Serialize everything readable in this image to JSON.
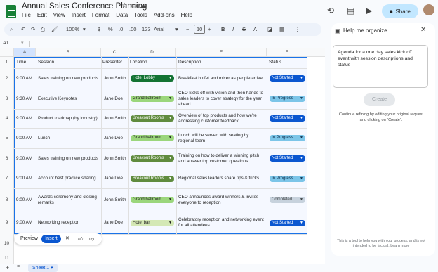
{
  "app": {
    "doc_title": "Annual Sales Conference Planning",
    "menus": [
      "File",
      "Edit",
      "View",
      "Insert",
      "Format",
      "Data",
      "Tools",
      "Add-ons",
      "Help"
    ],
    "share_label": "Share"
  },
  "toolbar": {
    "zoom": "100%",
    "currency": "$",
    "percent": "%",
    "dec_dec": ".0",
    "dec_inc": ".00",
    "format": "123",
    "font": "Arial",
    "font_size": "10",
    "bold": "B",
    "italic": "I",
    "strike": "S",
    "text_color": "A"
  },
  "formula": {
    "cell_ref": "A1"
  },
  "columns": [
    "A",
    "B",
    "C",
    "D",
    "E",
    "F"
  ],
  "header_row": {
    "row": "1",
    "time": "Time",
    "session": "Session",
    "presenter": "Presenter",
    "location": "Location",
    "description": "Description",
    "status": "Status"
  },
  "rows": [
    {
      "row": "2",
      "time": "9:00 AM",
      "session": "Sales training on new products",
      "presenter": "John Smith",
      "location": "Hotel Lobby",
      "description": "Breakfast buffet and mixer as people arrive",
      "status": "Not Started"
    },
    {
      "row": "3",
      "time": "9:30 AM",
      "session": "Executive Keynotes",
      "presenter": "Jane Doe",
      "location": "Grand ballroom",
      "description": "CEO kicks off with vision and then hands to sales leaders to cover strategy for the year ahead",
      "status": "In Progress"
    },
    {
      "row": "4",
      "time": "9:00 AM",
      "session": "Product roadmap (by industry)",
      "presenter": "John Smith",
      "location": "Breakout Rooms",
      "description": "Overview of top products and how we're addressing customer feedback",
      "status": "Not Started"
    },
    {
      "row": "5",
      "time": "9:00 AM",
      "session": "Lunch",
      "presenter": "Jane Doe",
      "location": "Grand ballroom",
      "description": "Lunch will be served with seating by regional team",
      "status": "In Progress"
    },
    {
      "row": "6",
      "time": "9:00 AM",
      "session": "Sales training on new products",
      "presenter": "John Smith",
      "location": "Breakout Rooms",
      "description": "Training on how to deliver a winning pitch and answer top customer questions",
      "status": "Not Started"
    },
    {
      "row": "7",
      "time": "9:00 AM",
      "session": "Account best practice sharing",
      "presenter": "Jane Doe",
      "location": "Breakout Rooms",
      "description": "Regional sales leaders share tips & tricks",
      "status": "In Progress"
    },
    {
      "row": "8",
      "time": "9:00 AM",
      "session": "Awards ceremony and closing remarks",
      "presenter": "John Smith",
      "location": "Grand ballroom",
      "description": "CEO announces award winners & invites everyone to reception",
      "status": "Completed"
    },
    {
      "row": "9",
      "time": "9:00 AM",
      "session": "Networking reception",
      "presenter": "Jane Doe",
      "location": "Hotel bar",
      "description": "Celebratory reception and networking event for all attendees",
      "status": "Not Started"
    }
  ],
  "extra_rows": [
    "10",
    "11"
  ],
  "preview_bar": {
    "preview": "Preview",
    "insert": "Insert"
  },
  "sheet_tab": "Sheet 1",
  "panel": {
    "title": "Help me organize",
    "prompt": "Agenda for a one day sales kick off event with session descriptions and status",
    "create": "Create",
    "hint": "Continue refining by editing your original request and clicking on “Create”.",
    "footer": "This is a tool to help you with your process, and is not intended to be factual. Learn more"
  },
  "colors": {
    "hotel_lobby": "#137333",
    "grand_ballroom": "#9bd67c",
    "breakout_rooms": "#5f8b3e",
    "hotel_bar": "#d4e8b5",
    "not_started": "#0b57d0",
    "in_progress": "#7cc5e8",
    "completed": "#c7d2dd"
  }
}
